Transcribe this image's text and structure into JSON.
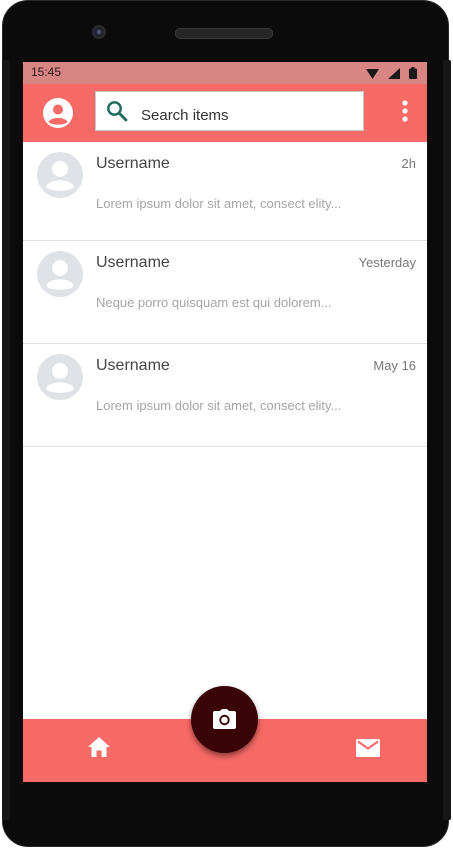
{
  "status_bar": {
    "time": "15:45",
    "icons": [
      "wifi-icon",
      "cellular-signal-icon",
      "battery-icon"
    ]
  },
  "app_bar": {
    "search_placeholder": "Search items",
    "icons": [
      "account-circle-icon",
      "search-icon",
      "more-vert-icon"
    ]
  },
  "messages": [
    {
      "username": "Username",
      "time": "2h",
      "preview": "Lorem ipsum dolor sit amet, consect elity..."
    },
    {
      "username": "Username",
      "time": "Yesterday",
      "preview": "Neque porro quisquam est qui dolorem..."
    },
    {
      "username": "Username",
      "time": "May 16",
      "preview": "Lorem ipsum dolor sit amet, consect elity..."
    }
  ],
  "bottom_nav": {
    "icons": [
      "home-icon",
      "camera-icon",
      "mail-icon"
    ]
  },
  "colors": {
    "accent": "#f76a66",
    "status_bar": "#d98583",
    "fab": "#3a0306"
  }
}
